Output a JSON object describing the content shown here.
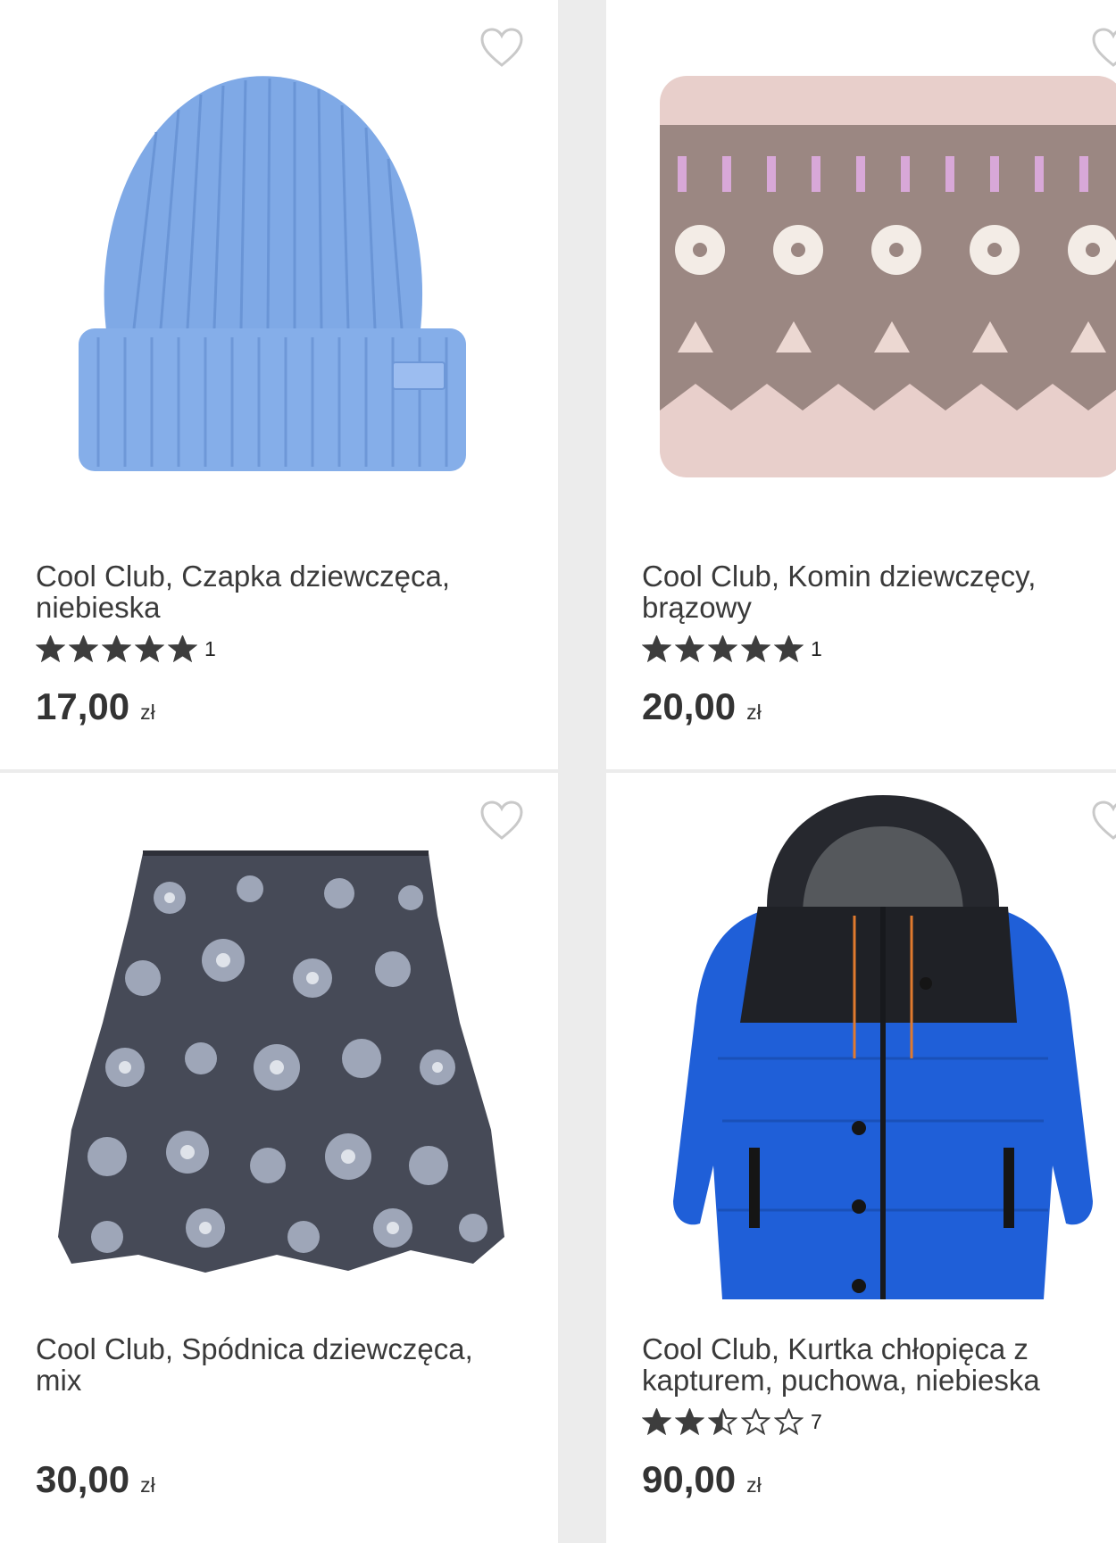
{
  "products": [
    {
      "title_line1": "Cool Club, Czapka dziewczęca,",
      "title_line2": "niebieska",
      "rating": 5,
      "rating_count": "1",
      "price": "17,00",
      "currency": "zł"
    },
    {
      "title_line1": "Cool Club, Komin dziewczęcy,",
      "title_line2": "brązowy",
      "rating": 5,
      "rating_count": "1",
      "price": "20,00",
      "currency": "zł"
    },
    {
      "title_line1": "Cool Club, Spódnica dziewczęca,",
      "title_line2": "mix",
      "rating": null,
      "rating_count": "",
      "price": "30,00",
      "currency": "zł"
    },
    {
      "title_line1": "Cool Club, Kurtka chłopięca z",
      "title_line2": "kapturem, puchowa, niebieska",
      "rating": 2.5,
      "rating_count": "7",
      "price": "90,00",
      "currency": "zł"
    }
  ],
  "icons": {
    "favorite": "heart-outline-icon",
    "star": "star-icon"
  },
  "colors": {
    "star_fill": "#3d3d3d",
    "heart_stroke": "#c9c9c9",
    "background": "#ececec"
  }
}
